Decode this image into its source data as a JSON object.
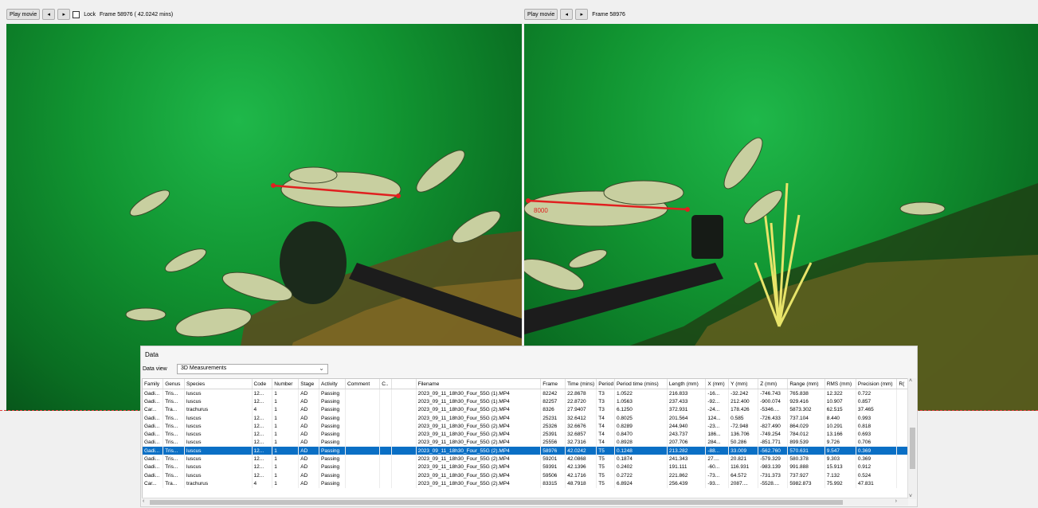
{
  "left_toolbar": {
    "play_label": "Play movie",
    "prev_label": "◂",
    "next_label": "▸",
    "lock_label": "Lock",
    "frame_text": "Frame 58976 ( 42.0242 mins)"
  },
  "right_toolbar": {
    "play_label": "Play movie",
    "prev_label": "◂",
    "next_label": "▸",
    "frame_text": "Frame 58976"
  },
  "right_frame_label": "8000",
  "data_panel": {
    "title": "Data",
    "data_view_label": "Data view",
    "data_view_value": "3D Measurements",
    "columns": [
      "Family",
      "Genus",
      "Species",
      "Code",
      "Number",
      "Stage",
      "Activity",
      "Comment",
      "C..",
      "",
      "Filename",
      "Frame",
      "Time (mins)",
      "Period",
      "Period time (mins)",
      "Length (mm)",
      "X (mm)",
      "Y (mm)",
      "Z (mm)",
      "Range (mm)",
      "RMS (mm)",
      "Precision (mm)",
      "R("
    ],
    "rows": [
      [
        "Gadi...",
        "Tris...",
        "luscus",
        "12...",
        "1",
        "AD",
        "Passing",
        "",
        "",
        "",
        "2023_09_11_18h30_Four_55G (1).MP4",
        "82242",
        "22.8678",
        "T3",
        "1.0522",
        "216.833",
        "-16...",
        "-32.242",
        "-746.743",
        "765.838",
        "12.322",
        "0.722",
        ""
      ],
      [
        "Gadi...",
        "Tris...",
        "luscus",
        "12...",
        "1",
        "AD",
        "Passing",
        "",
        "",
        "",
        "2023_09_11_18h30_Four_55G (1).MP4",
        "82257",
        "22.8720",
        "T3",
        "1.0563",
        "237.433",
        "-92...",
        "212.400",
        "-900.074",
        "929.416",
        "10.907",
        "0.857",
        ""
      ],
      [
        "Car...",
        "Tra...",
        "trachurus",
        "4",
        "1",
        "AD",
        "Passing",
        "",
        "",
        "",
        "2023_09_11_18h30_Four_55G (2).MP4",
        "8326",
        "27.9407",
        "T3",
        "6.1250",
        "372.931",
        "-24...",
        "178.426",
        "-5346....",
        "5873.302",
        "62.515",
        "37.465",
        ""
      ],
      [
        "Gadi...",
        "Tris...",
        "luscus",
        "12...",
        "1",
        "AD",
        "Passing",
        "",
        "",
        "",
        "2023_09_11_18h30_Four_55G (2).MP4",
        "25231",
        "32.6412",
        "T4",
        "0.8025",
        "201.564",
        "124...",
        "0.585",
        "-726.433",
        "737.104",
        "8.440",
        "0.993",
        ""
      ],
      [
        "Gadi...",
        "Tris...",
        "luscus",
        "12...",
        "1",
        "AD",
        "Passing",
        "",
        "",
        "",
        "2023_09_11_18h30_Four_55G (2).MP4",
        "25326",
        "32.6676",
        "T4",
        "0.8289",
        "244.940",
        "-23...",
        "-72.948",
        "-827.490",
        "864.029",
        "10.291",
        "0.818",
        ""
      ],
      [
        "Gadi...",
        "Tris...",
        "luscus",
        "12...",
        "1",
        "AD",
        "Passing",
        "",
        "",
        "",
        "2023_09_11_18h30_Four_55G (2).MP4",
        "25391",
        "32.6857",
        "T4",
        "0.8470",
        "243.737",
        "186...",
        "136.706",
        "-749.254",
        "784.012",
        "13.166",
        "0.693",
        ""
      ],
      [
        "Gadi...",
        "Tris...",
        "luscus",
        "12...",
        "1",
        "AD",
        "Passing",
        "",
        "",
        "",
        "2023_09_11_18h30_Four_55G (2).MP4",
        "25556",
        "32.7316",
        "T4",
        "0.8928",
        "207.706",
        "284...",
        "50.286",
        "-851.771",
        "899.539",
        "9.726",
        "0.706",
        ""
      ],
      [
        "Gadi...",
        "Tris...",
        "luscus",
        "12...",
        "1",
        "AD",
        "Passing",
        "",
        "",
        "",
        "2023_09_11_18h30_Four_55G (2).MP4",
        "58976",
        "42.0242",
        "T5",
        "0.1248",
        "213.282",
        "-88...",
        "33.009",
        "-562.760",
        "570.631",
        "9.547",
        "0.369",
        ""
      ],
      [
        "Gadi...",
        "Tris...",
        "luscus",
        "12...",
        "1",
        "AD",
        "Passing",
        "",
        "",
        "",
        "2023_09_11_18h30_Four_55G (2).MP4",
        "59201",
        "42.0868",
        "T5",
        "0.1874",
        "241.343",
        "27....",
        "20.821",
        "-579.329",
        "580.378",
        "9.303",
        "0.369",
        ""
      ],
      [
        "Gadi...",
        "Tris...",
        "luscus",
        "12...",
        "1",
        "AD",
        "Passing",
        "",
        "",
        "",
        "2023_09_11_18h30_Four_55G (2).MP4",
        "59391",
        "42.1396",
        "T5",
        "0.2402",
        "191.111",
        "-60...",
        "116.931",
        "-983.139",
        "991.888",
        "15.913",
        "0.912",
        ""
      ],
      [
        "Gadi...",
        "Tris...",
        "luscus",
        "12...",
        "1",
        "AD",
        "Passing",
        "",
        "",
        "",
        "2023_09_11_18h30_Four_55G (2).MP4",
        "59506",
        "42.1716",
        "T5",
        "0.2722",
        "221.862",
        "-73...",
        "64.572",
        "-731.373",
        "737.927",
        "7.132",
        "0.524",
        ""
      ],
      [
        "Car...",
        "Tra...",
        "trachurus",
        "4",
        "1",
        "AD",
        "Passing",
        "",
        "",
        "",
        "2023_09_11_18h30_Four_55G (2).MP4",
        "83315",
        "48.7918",
        "T5",
        "6.8924",
        "256.439",
        "-93...",
        "2087....",
        "-5528....",
        "5982.873",
        "75.992",
        "47.831",
        ""
      ]
    ],
    "selected_row": 7
  },
  "colors": {
    "selection": "#0a6fc5",
    "water": "#14a83c",
    "measure_line": "#e02020"
  }
}
